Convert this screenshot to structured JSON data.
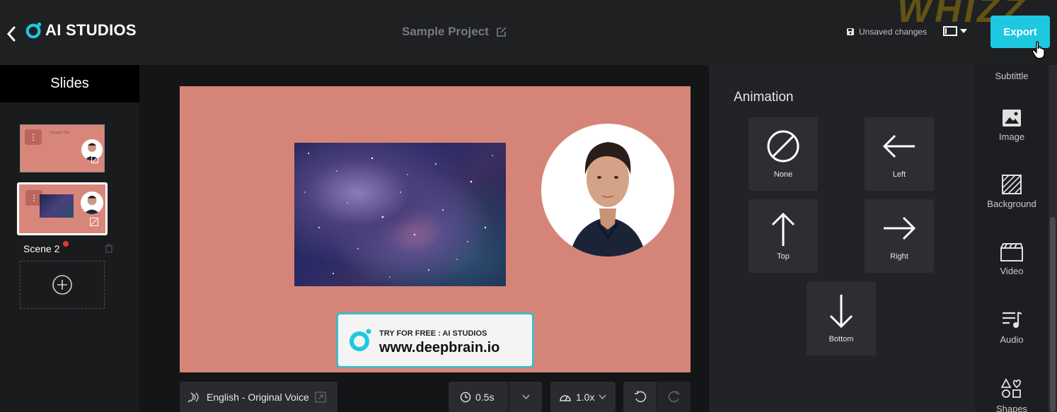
{
  "header": {
    "brand": "AI STUDIOS",
    "project_title": "Sample Project",
    "save_status": "Unsaved changes",
    "export_label": "Export",
    "watermark": "WHIZZ",
    "accent_color": "#1ec8e0"
  },
  "slides_panel": {
    "title": "Slides",
    "active_scene_label": "Scene 2",
    "scene1_thumb_text": "Sample Title"
  },
  "stage": {
    "background_color": "#d58578",
    "promo_small": "TRY FOR FREE : AI STUDIOS",
    "promo_big": "www.deepbrain.io"
  },
  "bottom_bar": {
    "voice_label": "English - Original Voice",
    "duration_value": "0.5s",
    "speed_value": "1.0x"
  },
  "animation_panel": {
    "title": "Animation",
    "options": [
      {
        "label": "None",
        "icon": "none-icon"
      },
      {
        "label": "Left",
        "icon": "arrow-left-icon"
      },
      {
        "label": "Top",
        "icon": "arrow-up-icon"
      },
      {
        "label": "Right",
        "icon": "arrow-right-icon"
      },
      {
        "label": "Bottom",
        "icon": "arrow-down-icon"
      }
    ]
  },
  "toolbar": {
    "items": [
      {
        "label": "Subtittle",
        "icon": "subtitle-icon"
      },
      {
        "label": "Image",
        "icon": "image-icon"
      },
      {
        "label": "Background",
        "icon": "background-icon"
      },
      {
        "label": "Video",
        "icon": "video-icon"
      },
      {
        "label": "Audio",
        "icon": "audio-icon"
      },
      {
        "label": "Shapes",
        "icon": "shapes-icon"
      }
    ]
  }
}
